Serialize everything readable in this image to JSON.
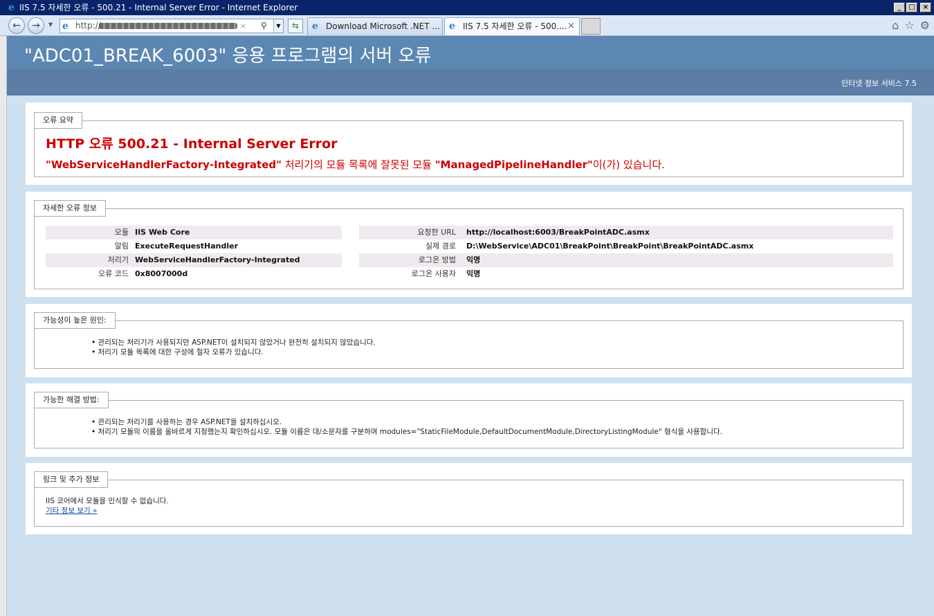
{
  "window": {
    "title": "IIS 7.5 자세한 오류 - 500.21 - Internal Server Error - Internet Explorer"
  },
  "toolbar": {
    "address_prefix": "http://",
    "tabs": [
      {
        "label": "Download Microsoft .NET ..."
      },
      {
        "label": "IIS 7.5 자세한 오류 - 500...."
      }
    ]
  },
  "page": {
    "heading": "\"ADC01_BREAK_6003\" 응용 프로그램의 서버 오류",
    "subheading": "인터넷 정보 서비스 7.5"
  },
  "summary": {
    "legend": "오류 요약",
    "title": "HTTP 오류 500.21 - Internal Server Error",
    "desc_part1": "\"WebServiceHandlerFactory-Integrated\"",
    "desc_part2": " 처리기의 모듈 목록에 잘못된 모듈 ",
    "desc_part3": "\"ManagedPipelineHandler\"",
    "desc_part4": "이(가) 있습니다."
  },
  "details": {
    "legend": "자세한 오류 정보",
    "left": [
      {
        "key": "모듈",
        "value": "IIS Web Core"
      },
      {
        "key": "알림",
        "value": "ExecuteRequestHandler"
      },
      {
        "key": "처리기",
        "value": "WebServiceHandlerFactory-Integrated"
      },
      {
        "key": "오류 코드",
        "value": "0x8007000d"
      }
    ],
    "right": [
      {
        "key": "요청한 URL",
        "value": "http://localhost:6003/BreakPointADC.asmx"
      },
      {
        "key": "실제 경로",
        "value": "D:\\WebService\\ADC01\\BreakPoint\\BreakPoint\\BreakPointADC.asmx"
      },
      {
        "key": "로그온 방법",
        "value": "익명"
      },
      {
        "key": "로그온 사용자",
        "value": "익명"
      }
    ]
  },
  "causes": {
    "legend": "가능성이 높은 원인:",
    "items": [
      "관리되는 처리기가 사용되지만 ASP.NET이 설치되지 않았거나 완전히 설치되지 않았습니다.",
      "처리기 모듈 목록에 대한 구성에 철자 오류가 있습니다."
    ]
  },
  "solutions": {
    "legend": "가능한 해결 방법:",
    "items": [
      "관리되는 처리기를 사용하는 경우 ASP.NET을 설치하십시오.",
      "처리기 모듈의 이름을 올바르게 지정했는지 확인하십시오. 모듈 이름은 대/소문자를 구분하며 modules=\"StaticFileModule,DefaultDocumentModule,DirectoryListingModule\" 형식을 사용합니다."
    ]
  },
  "links": {
    "legend": "링크 및 추가 정보",
    "text": "IIS 코어에서 모듈을 인식할 수 없습니다.",
    "link": "기타 정보 보기 »"
  }
}
